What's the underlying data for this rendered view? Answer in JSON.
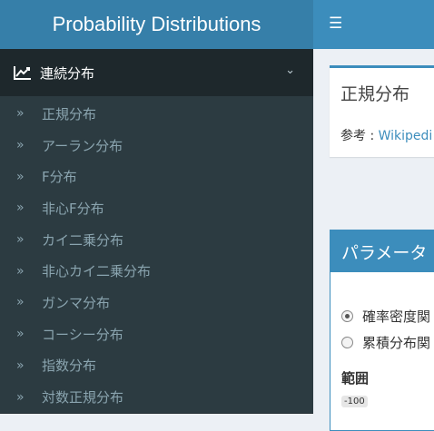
{
  "header": {
    "title": "Probability Distributions",
    "menu_icon": "hamburger-icon"
  },
  "sidebar": {
    "section": {
      "label": "連続分布",
      "icon": "line-chart-icon",
      "expand_icon": "chevron-down-icon"
    },
    "items": [
      {
        "label": "正規分布"
      },
      {
        "label": "アーラン分布"
      },
      {
        "label": "F分布"
      },
      {
        "label": "非心F分布"
      },
      {
        "label": "カイ二乗分布"
      },
      {
        "label": "非心カイ二乗分布"
      },
      {
        "label": "ガンマ分布"
      },
      {
        "label": "コーシー分布"
      },
      {
        "label": "指数分布"
      },
      {
        "label": "対数正規分布"
      }
    ]
  },
  "main": {
    "info_box": {
      "title": "正規分布",
      "ref_prefix": "参考 : ",
      "ref_link": "Wikipedi"
    },
    "param_box": {
      "title": "パラメータ",
      "options": [
        {
          "label": "確率密度関",
          "checked": true
        },
        {
          "label": "累積分布関",
          "checked": false
        }
      ],
      "range_label": "範囲",
      "range_min": "-100"
    }
  }
}
